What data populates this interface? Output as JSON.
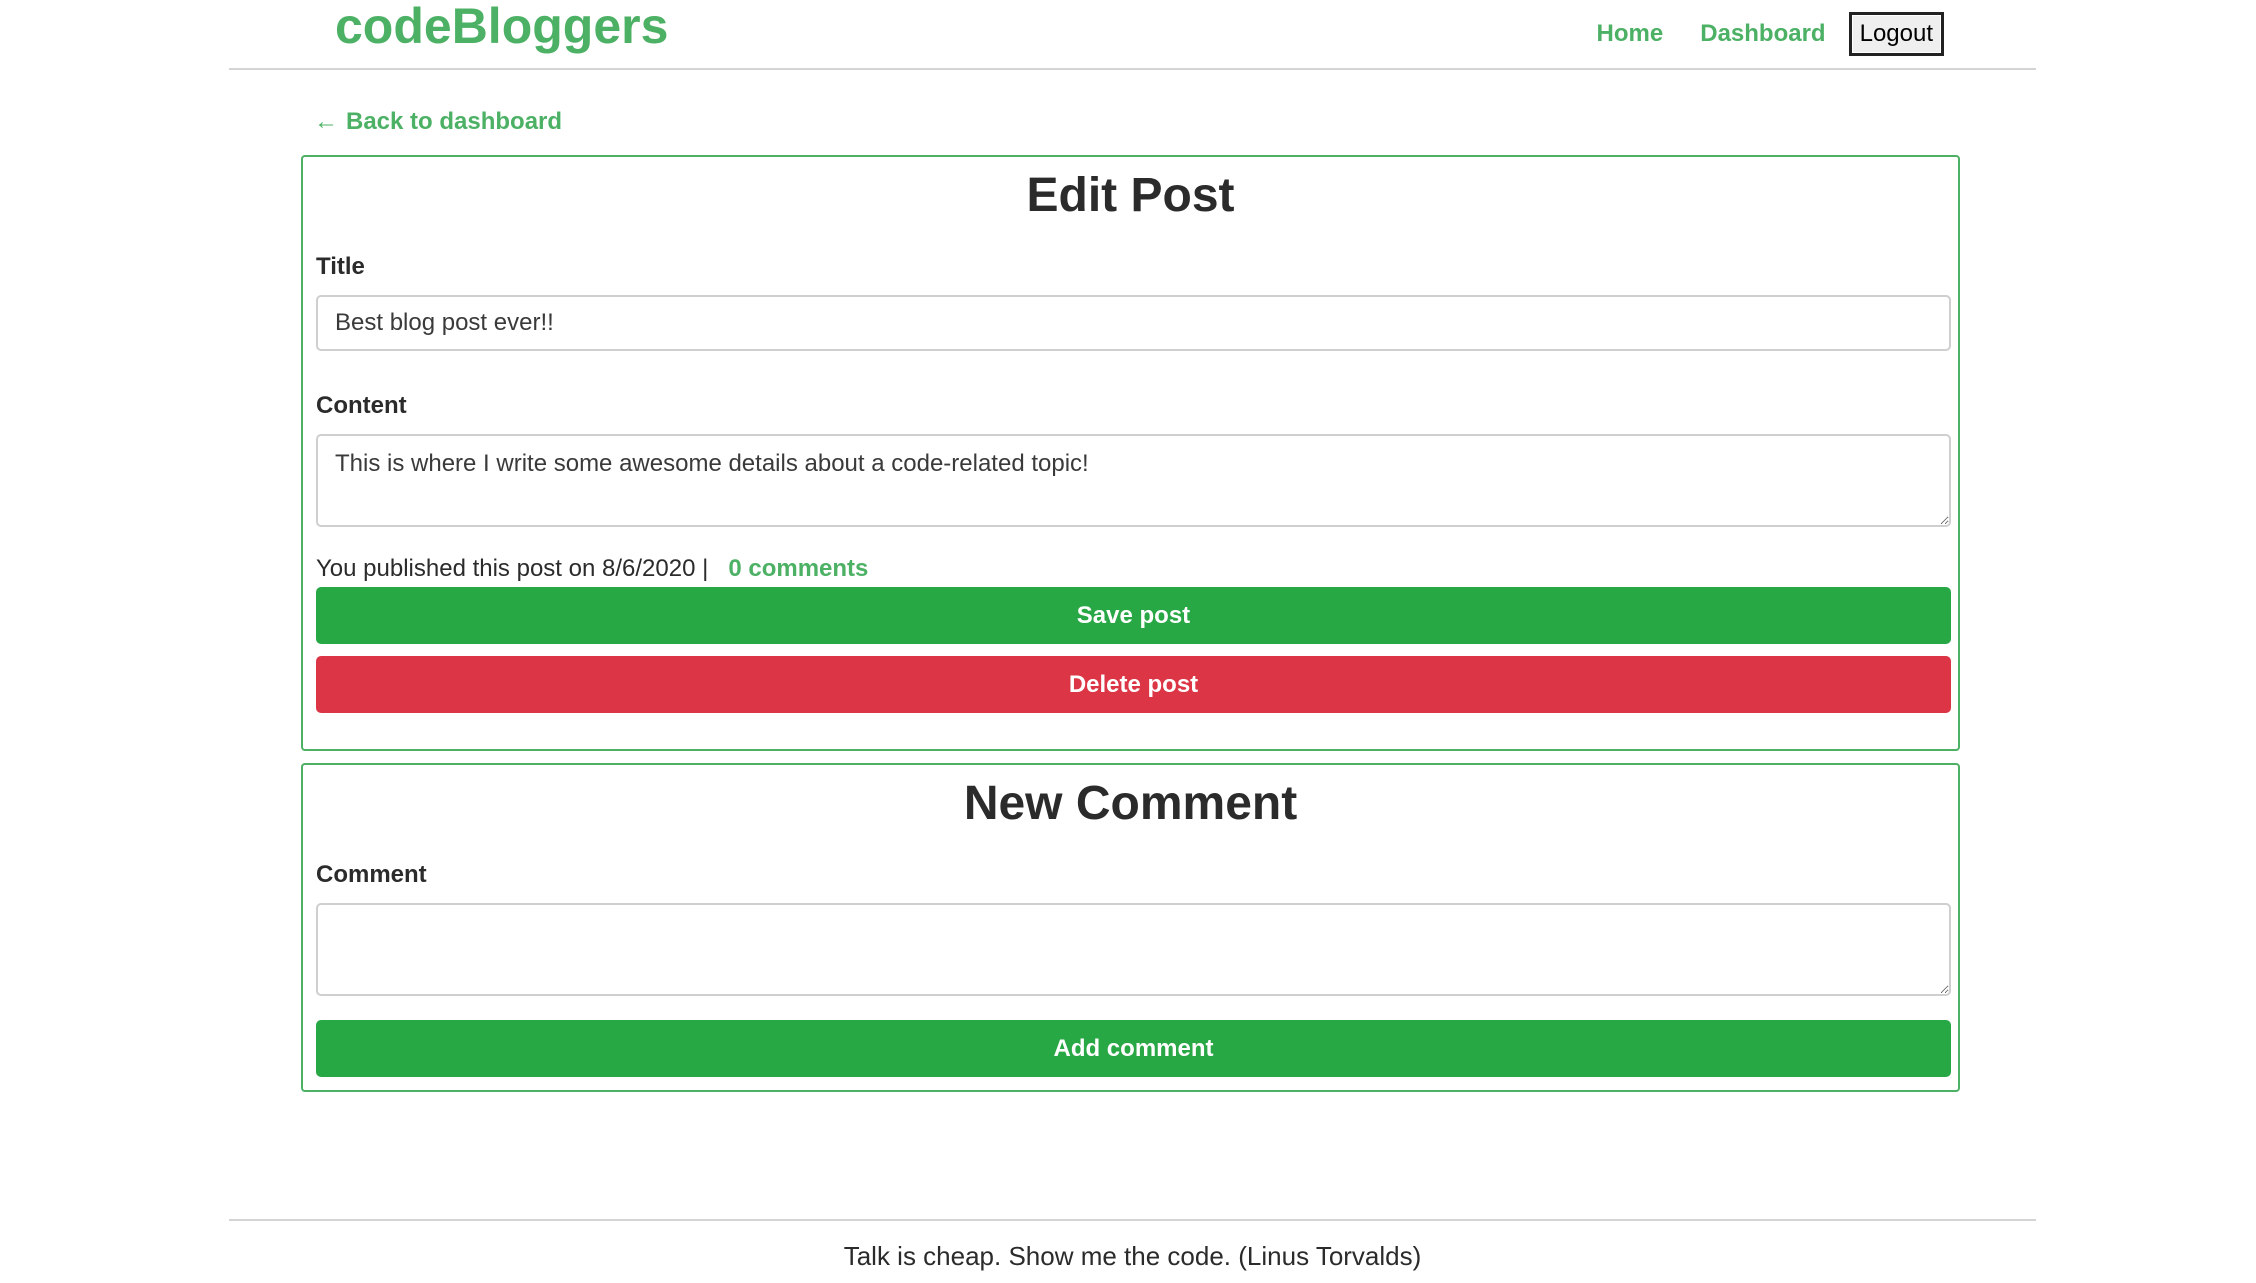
{
  "header": {
    "brand": "codeBloggers",
    "nav": {
      "home": "Home",
      "dashboard": "Dashboard",
      "logout": "Logout"
    }
  },
  "back_link": {
    "arrow": "←",
    "label": "Back to dashboard"
  },
  "edit_post": {
    "title": "Edit Post",
    "title_label": "Title",
    "title_value": "Best blog post ever!!",
    "content_label": "Content",
    "content_value": "This is where I write some awesome details about a code-related topic!",
    "published_text": "You published this post on 8/6/2020 |",
    "comments_link": "0 comments",
    "save_button": "Save post",
    "delete_button": "Delete post"
  },
  "new_comment": {
    "title": "New Comment",
    "comment_label": "Comment",
    "comment_value": "",
    "add_button": "Add comment"
  },
  "footer": {
    "quote": "Talk is cheap. Show me the code. (Linus Torvalds)"
  },
  "colors": {
    "brand_green": "#4cb165",
    "button_green": "#28a745",
    "button_red": "#dc3545"
  }
}
